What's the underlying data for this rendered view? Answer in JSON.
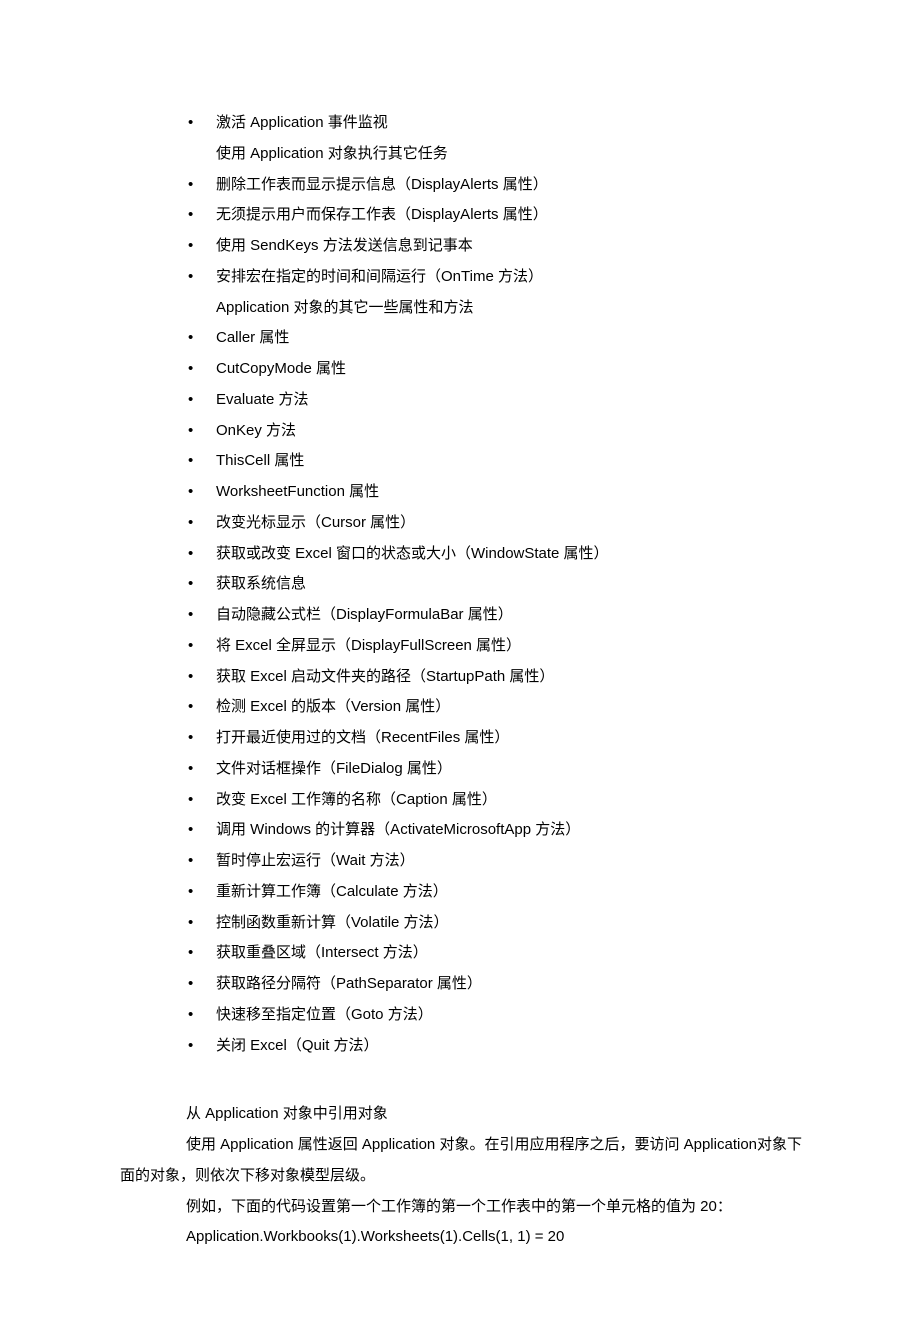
{
  "bullets": [
    {
      "text": "激活 Application 事件监视",
      "sub": "使用 Application 对象执行其它任务"
    },
    {
      "text": "删除工作表而显示提示信息（DisplayAlerts 属性）"
    },
    {
      "text": "无须提示用户而保存工作表（DisplayAlerts 属性）"
    },
    {
      "text": "使用 SendKeys 方法发送信息到记事本"
    },
    {
      "text": "安排宏在指定的时间和间隔运行（OnTime 方法）",
      "sub": "Application 对象的其它一些属性和方法"
    },
    {
      "text": "Caller 属性"
    },
    {
      "text": "CutCopyMode 属性"
    },
    {
      "text": "Evaluate 方法"
    },
    {
      "text": "OnKey 方法"
    },
    {
      "text": "ThisCell 属性"
    },
    {
      "text": "WorksheetFunction 属性"
    },
    {
      "text": "改变光标显示（Cursor 属性）"
    },
    {
      "text": "获取或改变 Excel 窗口的状态或大小（WindowState 属性）"
    },
    {
      "text": "获取系统信息"
    },
    {
      "text": "自动隐藏公式栏（DisplayFormulaBar 属性）"
    },
    {
      "text": "将 Excel 全屏显示（DisplayFullScreen 属性）"
    },
    {
      "text": "获取 Excel 启动文件夹的路径（StartupPath 属性）"
    },
    {
      "text": "检测 Excel 的版本（Version 属性）"
    },
    {
      "text": "打开最近使用过的文档（RecentFiles 属性）"
    },
    {
      "text": "文件对话框操作（FileDialog 属性）"
    },
    {
      "text": "改变 Excel 工作簿的名称（Caption 属性）"
    },
    {
      "text": "调用 Windows 的计算器（ActivateMicrosoftApp 方法）"
    },
    {
      "text": "暂时停止宏运行（Wait 方法）"
    },
    {
      "text": "重新计算工作簿（Calculate 方法）"
    },
    {
      "text": "控制函数重新计算（Volatile 方法）"
    },
    {
      "text": "获取重叠区域（Intersect 方法）"
    },
    {
      "text": "获取路径分隔符（PathSeparator 属性）"
    },
    {
      "text": "快速移至指定位置（Goto 方法）"
    },
    {
      "text": "关闭 Excel（Quit 方法）"
    }
  ],
  "paragraphs": {
    "p1": "从 Application 对象中引用对象",
    "p2": "使用 Application 属性返回 Application 对象。在引用应用程序之后，要访问 Application对象下面的对象，则依次下移对象模型层级。",
    "p3": "例如，下面的代码设置第一个工作簿的第一个工作表中的第一个单元格的值为 20：",
    "p4": "Application.Workbooks(1).Worksheets(1).Cells(1, 1) = 20"
  }
}
